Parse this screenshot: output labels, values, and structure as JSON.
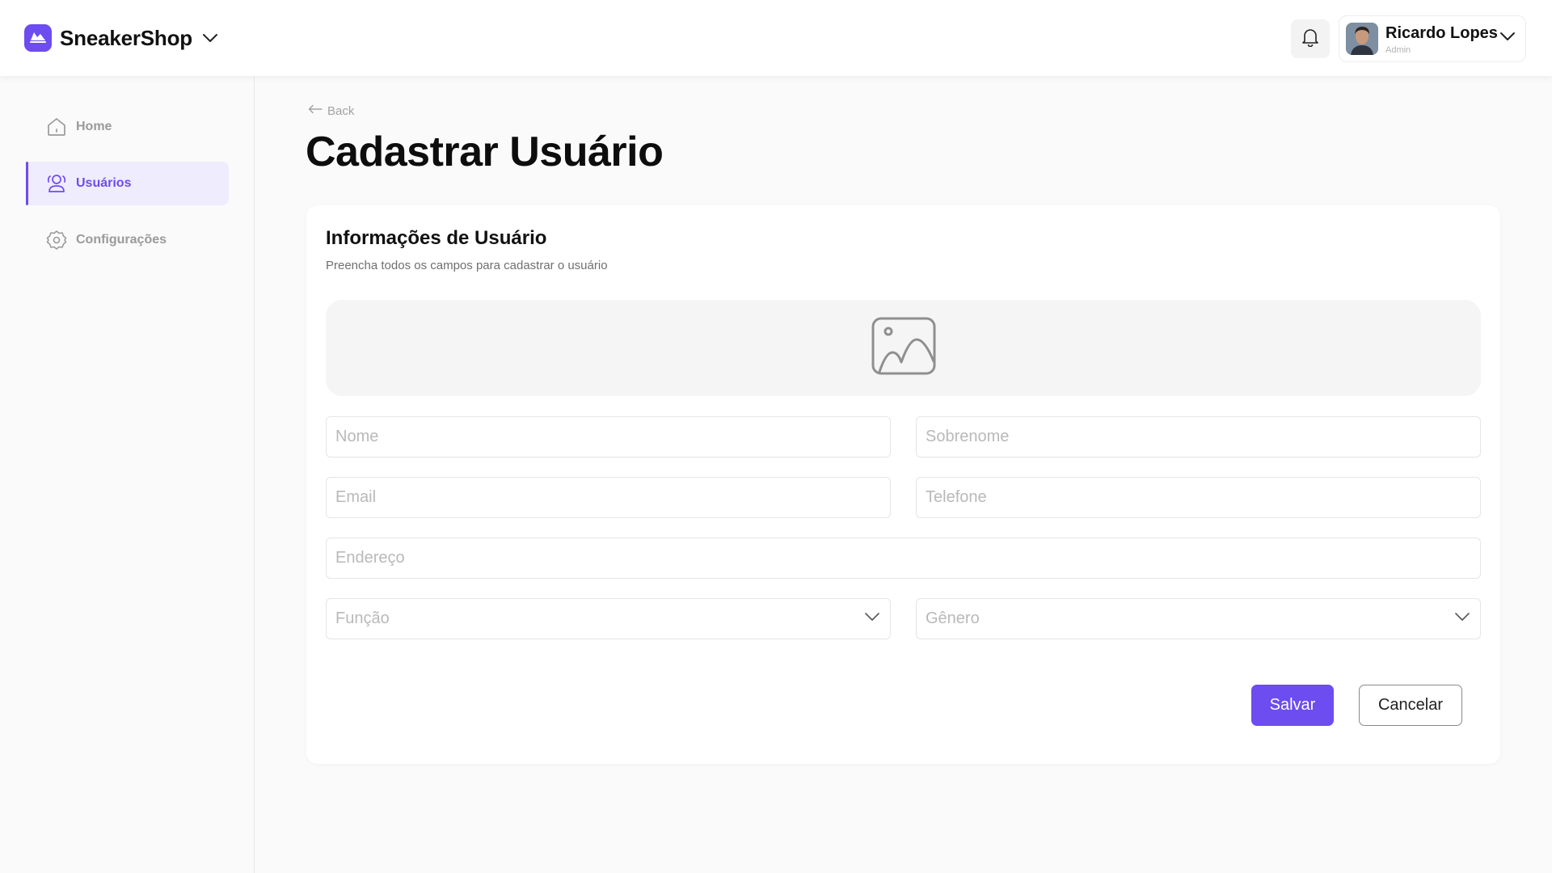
{
  "header": {
    "brand_name": "SneakerShop",
    "user": {
      "name": "Ricardo Lopes",
      "role": "Admin"
    }
  },
  "sidebar": {
    "items": [
      {
        "label": "Home",
        "icon": "home-icon",
        "active": false
      },
      {
        "label": "Usuários",
        "icon": "users-icon",
        "active": true
      },
      {
        "label": "Configurações",
        "icon": "gear-icon",
        "active": false
      }
    ]
  },
  "main": {
    "back_label": "Back",
    "title": "Cadastrar Usuário",
    "card": {
      "title": "Informações de Usuário",
      "subtitle": "Preencha todos os campos para cadastrar o usuário",
      "image_icon": "image-placeholder-icon",
      "fields": {
        "first_name": {
          "placeholder": "Nome",
          "value": ""
        },
        "last_name": {
          "placeholder": "Sobrenome",
          "value": ""
        },
        "email": {
          "placeholder": "Email",
          "value": ""
        },
        "phone": {
          "placeholder": "Telefone",
          "value": ""
        },
        "address": {
          "placeholder": "Endereço",
          "value": ""
        },
        "role": {
          "placeholder": "Função"
        },
        "gender": {
          "placeholder": "Gênero"
        }
      },
      "save_label": "Salvar",
      "cancel_label": "Cancelar"
    }
  },
  "colors": {
    "accent": "#6d4cf0",
    "accent_light": "#efecfd",
    "muted_text": "#9a9a9a"
  }
}
